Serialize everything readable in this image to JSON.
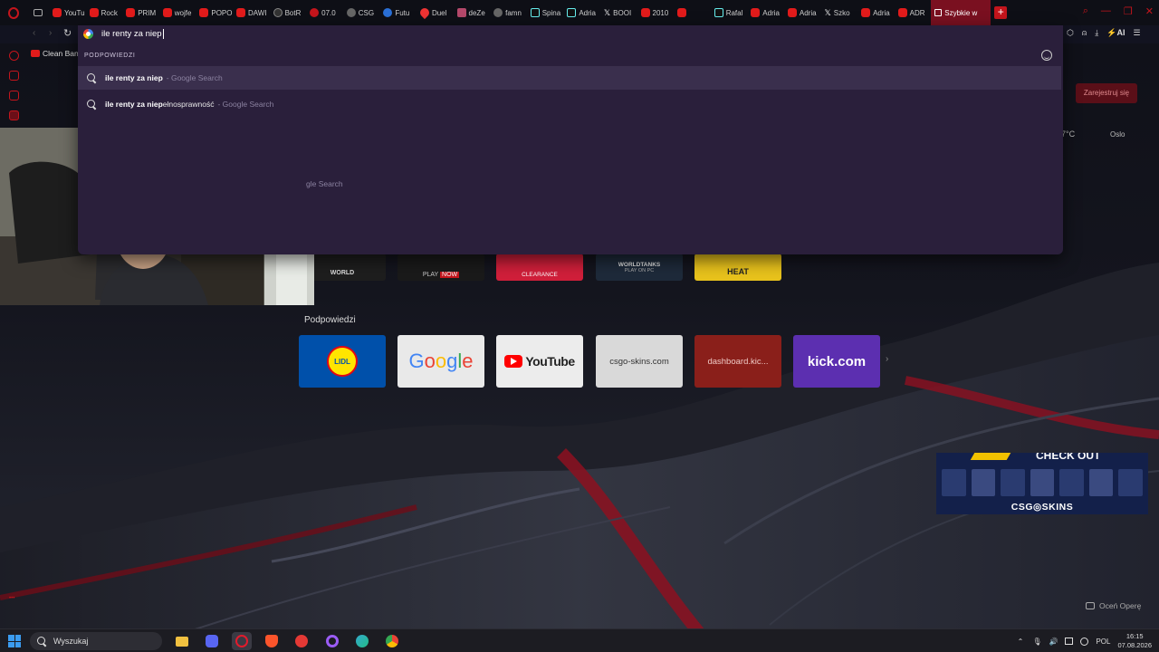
{
  "tabstrip": {
    "tabs": [
      {
        "label": "YouTu",
        "icon": "youtube-icon",
        "fav": "yt"
      },
      {
        "label": "Rock",
        "icon": "youtube-icon",
        "fav": "yt"
      },
      {
        "label": "PRIM",
        "icon": "youtube-icon",
        "fav": "yt"
      },
      {
        "label": "wojfe",
        "icon": "youtube-icon",
        "fav": "yt"
      },
      {
        "label": "POPO",
        "icon": "youtube-icon",
        "fav": "yt"
      },
      {
        "label": "DAWI",
        "icon": "youtube-icon",
        "fav": "yt"
      },
      {
        "label": "BotR",
        "icon": "bot-icon",
        "fav": "dark"
      },
      {
        "label": "07.0",
        "icon": "red-circle-icon",
        "fav": "red"
      },
      {
        "label": "CSG",
        "icon": "csgo-icon",
        "fav": "grey"
      },
      {
        "label": "Futu",
        "icon": "globe-icon",
        "fav": "blue"
      },
      {
        "label": "Duel",
        "icon": "pin-icon",
        "fav": "pin"
      },
      {
        "label": "deZe",
        "icon": "grid-icon",
        "fav": "pink"
      },
      {
        "label": "famn",
        "icon": "google-icon",
        "fav": "grey"
      },
      {
        "label": "Spina",
        "icon": "tiktok-icon",
        "fav": "tk"
      },
      {
        "label": "Adria",
        "icon": "tiktok-icon",
        "fav": "tk"
      },
      {
        "label": "BOOI",
        "icon": "x-icon",
        "fav": "x"
      },
      {
        "label": "2010",
        "icon": "youtube-icon",
        "fav": "yt"
      },
      {
        "label": "",
        "icon": "youtube-icon",
        "fav": "yt"
      },
      {
        "label": "Rafal",
        "icon": "tiktok-icon",
        "fav": "tk"
      },
      {
        "label": "Adria",
        "icon": "youtube-icon",
        "fav": "yt"
      },
      {
        "label": "Adria",
        "icon": "youtube-icon",
        "fav": "yt"
      },
      {
        "label": "Szko",
        "icon": "x-icon",
        "fav": "x"
      },
      {
        "label": "Adria",
        "icon": "youtube-icon",
        "fav": "yt"
      },
      {
        "label": "ADR",
        "icon": "youtube-icon",
        "fav": "yt"
      }
    ],
    "active_tab": {
      "label": "Szybkie w",
      "icon": "speed-dial-icon"
    },
    "new_tab_glyph": "+",
    "search_glyph": "⌕",
    "minimize_glyph": "—",
    "maximize_glyph": "❐",
    "close_glyph": "✕"
  },
  "toolbar": {
    "back_glyph": "‹",
    "forward_glyph": "›",
    "reload_glyph": "↻",
    "extensions_glyph": "⬡",
    "profile_glyph": "⍝",
    "download_glyph": "⤓",
    "ai_label": "⚡AI",
    "menu_glyph": "☰"
  },
  "sidebar": {
    "more_glyph": "•••"
  },
  "bookmarks": [
    "Clean Ban"
  ],
  "omnibox": {
    "query": "ile renty za niep",
    "heading": "PODPOWIEDZI",
    "suggestions": [
      {
        "bold": "ile renty za niep",
        "rest": "",
        "source": "- Google Search"
      },
      {
        "bold": "ile renty za niep",
        "rest": "ełnosprawność",
        "source": "- Google Search"
      }
    ],
    "obscured_source": "gle Search"
  },
  "page": {
    "register_label": "Zarejestruj się",
    "temperature": "7°C",
    "city": "Oslo",
    "rate_label": "Oceń Operę"
  },
  "partial_tiles": [
    "WORLD",
    "PLAY",
    "NOW",
    "CLEARANCE",
    "WORLDTANKS",
    "PLAY ON PC",
    "HEAT"
  ],
  "speed_dial": {
    "title": "Podpowiedzi",
    "google_letters": [
      "G",
      "o",
      "o",
      "g",
      "l",
      "e"
    ],
    "tiles": [
      {
        "label": "LIDL"
      },
      {
        "label": "Google"
      },
      {
        "label": "YouTube"
      },
      {
        "label": "csgo-skins.com"
      },
      {
        "label": "dashboard.kic..."
      },
      {
        "label": "kick.com"
      }
    ],
    "next_glyph": "›"
  },
  "ad": {
    "headline": "CHECK OUT",
    "brand": "CSG◎SKINS"
  },
  "taskbar": {
    "search_label": "Wyszukaj",
    "chevron_glyph": "⌃",
    "mic_glyph": "🎙",
    "volume_glyph": "🔊",
    "language": "POL",
    "time": "16:15",
    "date": "07.08.2026"
  }
}
